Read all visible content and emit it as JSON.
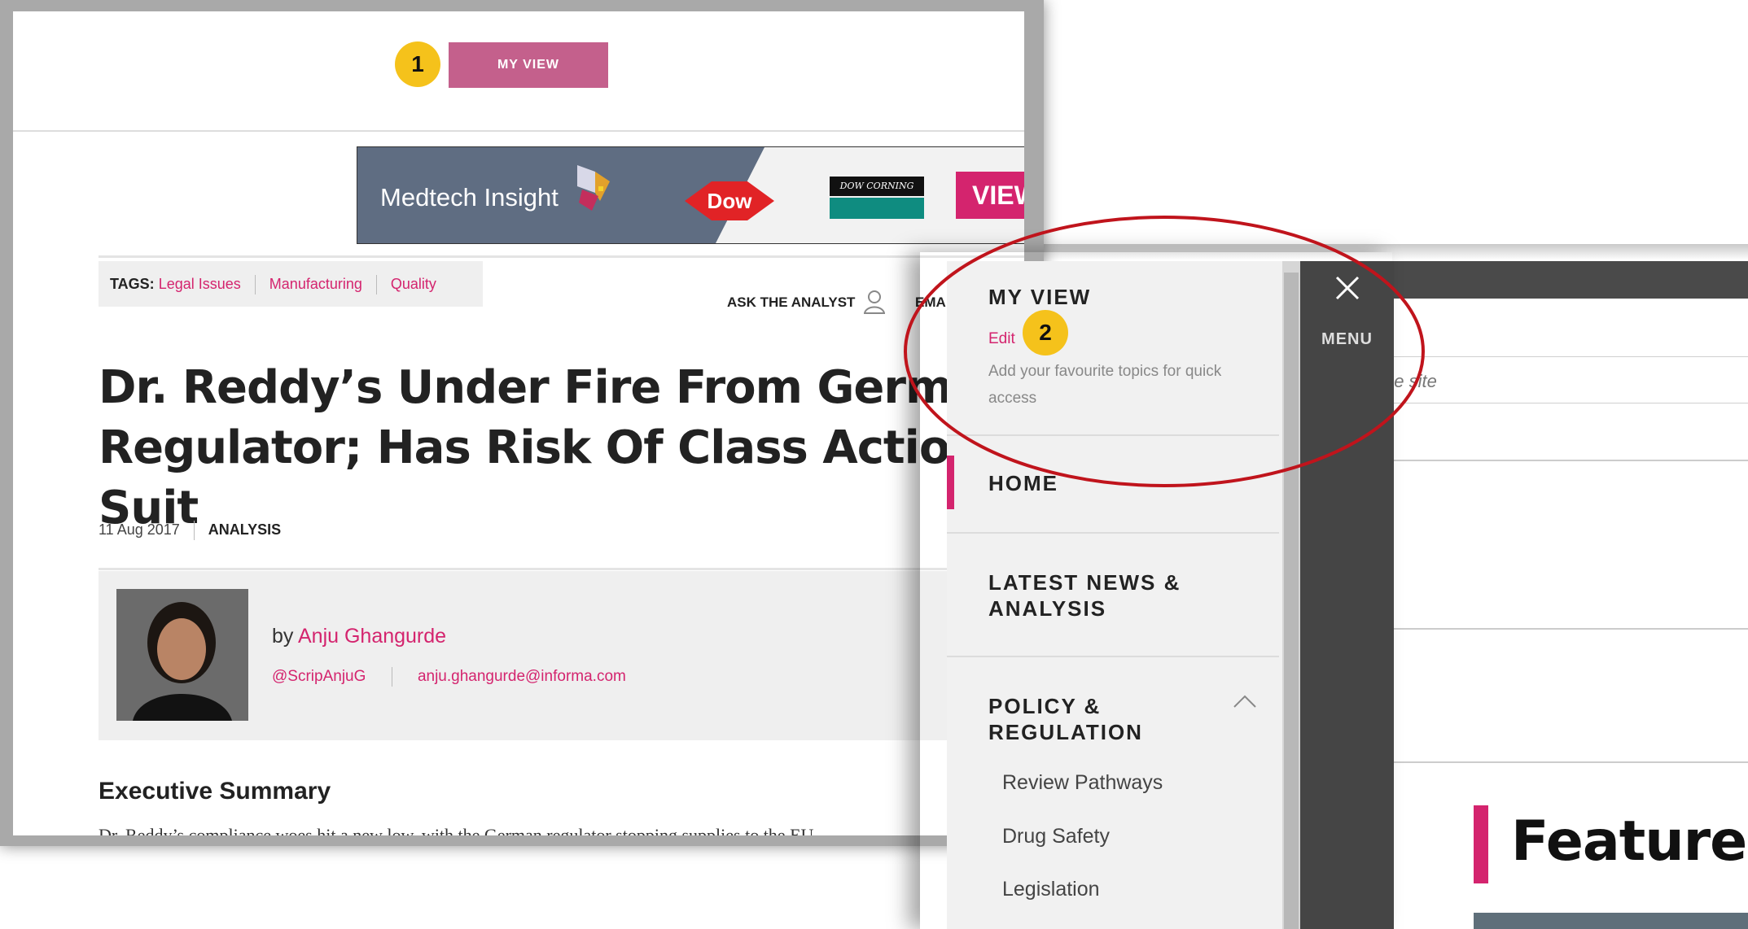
{
  "annotations": {
    "badge1": "1",
    "badge2": "2"
  },
  "article": {
    "my_view_button": "MY VIEW",
    "banner": {
      "brand": "Medtech Insight",
      "sponsor1": "Dow",
      "sponsor2": "DOW CORNING",
      "cta": "VIEW"
    },
    "tags_label": "TAGS:",
    "tags": [
      "Legal Issues",
      "Manufacturing",
      "Quality"
    ],
    "ask_analyst": "ASK THE ANALYST",
    "email_partial": "EMA",
    "headline": "Dr. Reddy’s Under Fire From German Regulator; Has Risk Of Class Action Suit",
    "date": "11 Aug 2017",
    "type": "ANALYSIS",
    "author": {
      "by": "by",
      "name": "Anju Ghangurde",
      "twitter": "@ScripAnjuG",
      "email": "anju.ghangurde@informa.com"
    },
    "section_title": "Executive Summary",
    "body_start": "Dr. Reddy’s compliance woes hit a new low, with the German regulator stopping supplies to the EU"
  },
  "menu": {
    "my_view_title": "MY VIEW",
    "edit_label": "Edit",
    "my_view_desc": "Add your favourite topics for quick access",
    "rail_label": "MENU",
    "items": [
      "HOME",
      "LATEST NEWS & ANALYSIS",
      "POLICY & REGULATION"
    ],
    "subitems": [
      "Review Pathways",
      "Drug Safety",
      "Legislation"
    ]
  },
  "background_page": {
    "search_placeholder_partial": "ne site",
    "featured_title": "Featured"
  },
  "colors": {
    "accent": "#d4246e",
    "my_view_button": "#c4608c",
    "badge": "#f5c21b",
    "ellipse": "#c0141c"
  }
}
